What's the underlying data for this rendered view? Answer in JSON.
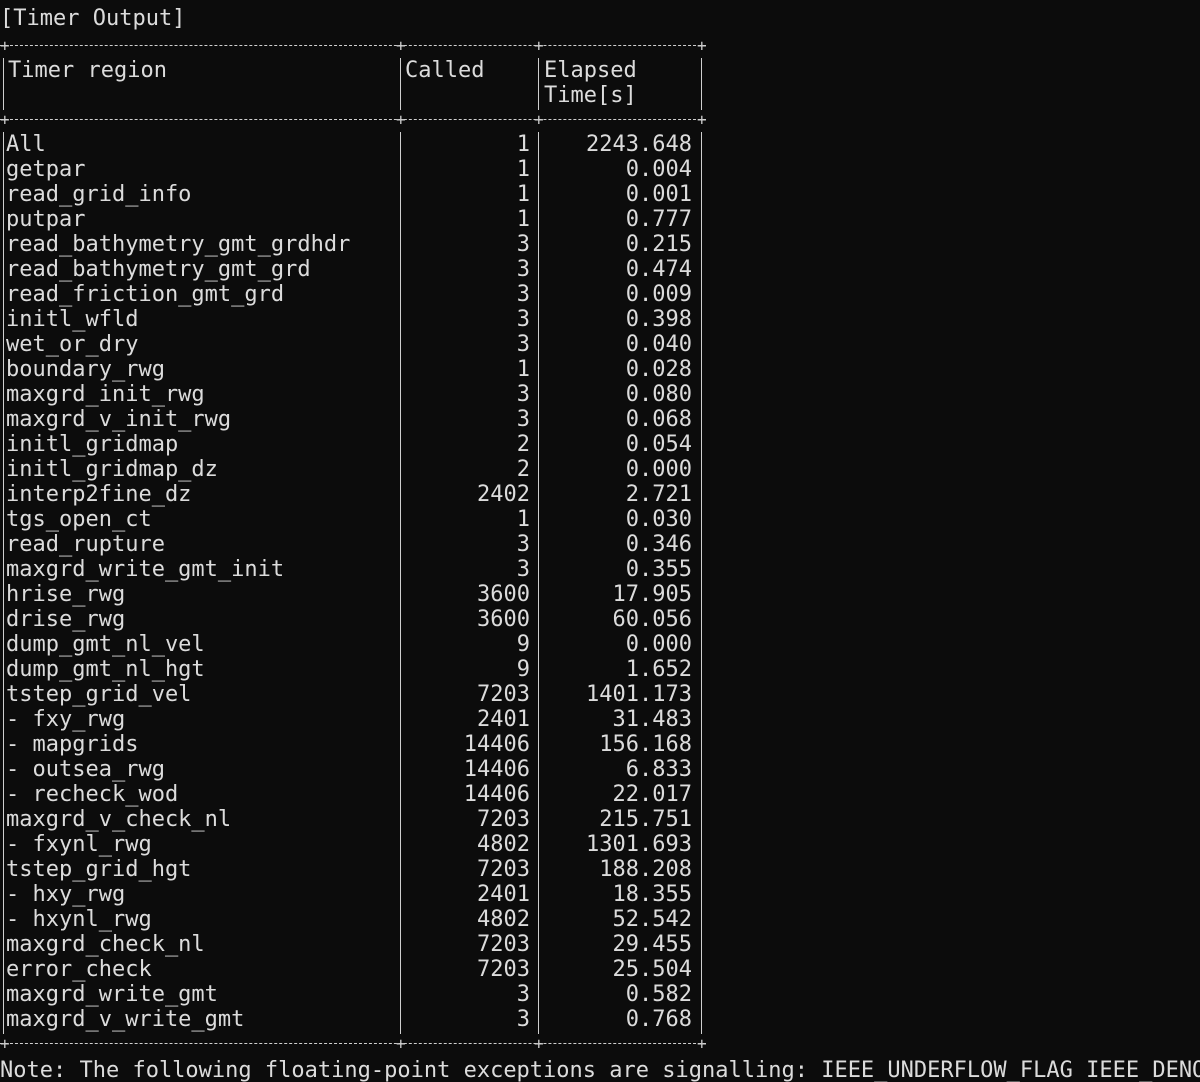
{
  "title": "[Timer Output]",
  "header": {
    "col1": "Timer region",
    "col2": "Called",
    "col3_line1": "Elapsed",
    "col3_line2": "Time[s]"
  },
  "rows": [
    {
      "name": "All",
      "called": "1",
      "elapsed": "2243.648"
    },
    {
      "name": "getpar",
      "called": "1",
      "elapsed": "0.004"
    },
    {
      "name": "read_grid_info",
      "called": "1",
      "elapsed": "0.001"
    },
    {
      "name": "putpar",
      "called": "1",
      "elapsed": "0.777"
    },
    {
      "name": "read_bathymetry_gmt_grdhdr",
      "called": "3",
      "elapsed": "0.215"
    },
    {
      "name": "read_bathymetry_gmt_grd",
      "called": "3",
      "elapsed": "0.474"
    },
    {
      "name": "read_friction_gmt_grd",
      "called": "3",
      "elapsed": "0.009"
    },
    {
      "name": "initl_wfld",
      "called": "3",
      "elapsed": "0.398"
    },
    {
      "name": "wet_or_dry",
      "called": "3",
      "elapsed": "0.040"
    },
    {
      "name": "boundary_rwg",
      "called": "1",
      "elapsed": "0.028"
    },
    {
      "name": "maxgrd_init_rwg",
      "called": "3",
      "elapsed": "0.080"
    },
    {
      "name": "maxgrd_v_init_rwg",
      "called": "3",
      "elapsed": "0.068"
    },
    {
      "name": "initl_gridmap",
      "called": "2",
      "elapsed": "0.054"
    },
    {
      "name": "initl_gridmap_dz",
      "called": "2",
      "elapsed": "0.000"
    },
    {
      "name": "interp2fine_dz",
      "called": "2402",
      "elapsed": "2.721"
    },
    {
      "name": "tgs_open_ct",
      "called": "1",
      "elapsed": "0.030"
    },
    {
      "name": "read_rupture",
      "called": "3",
      "elapsed": "0.346"
    },
    {
      "name": "maxgrd_write_gmt_init",
      "called": "3",
      "elapsed": "0.355"
    },
    {
      "name": "hrise_rwg",
      "called": "3600",
      "elapsed": "17.905"
    },
    {
      "name": "drise_rwg",
      "called": "3600",
      "elapsed": "60.056"
    },
    {
      "name": "dump_gmt_nl_vel",
      "called": "9",
      "elapsed": "0.000"
    },
    {
      "name": "dump_gmt_nl_hgt",
      "called": "9",
      "elapsed": "1.652"
    },
    {
      "name": "tstep_grid_vel",
      "called": "7203",
      "elapsed": "1401.173"
    },
    {
      "name": "- fxy_rwg",
      "called": "2401",
      "elapsed": "31.483"
    },
    {
      "name": "- mapgrids",
      "called": "14406",
      "elapsed": "156.168"
    },
    {
      "name": "- outsea_rwg",
      "called": "14406",
      "elapsed": "6.833"
    },
    {
      "name": "- recheck_wod",
      "called": "14406",
      "elapsed": "22.017"
    },
    {
      "name": "maxgrd_v_check_nl",
      "called": "7203",
      "elapsed": "215.751"
    },
    {
      "name": "- fxynl_rwg",
      "called": "4802",
      "elapsed": "1301.693"
    },
    {
      "name": "tstep_grid_hgt",
      "called": "7203",
      "elapsed": "188.208"
    },
    {
      "name": "- hxy_rwg",
      "called": "2401",
      "elapsed": "18.355"
    },
    {
      "name": "- hxynl_rwg",
      "called": "4802",
      "elapsed": "52.542"
    },
    {
      "name": "maxgrd_check_nl",
      "called": "7203",
      "elapsed": "29.455"
    },
    {
      "name": "error_check",
      "called": "7203",
      "elapsed": "25.504"
    },
    {
      "name": "maxgrd_write_gmt",
      "called": "3",
      "elapsed": "0.582"
    },
    {
      "name": "maxgrd_v_write_gmt",
      "called": "3",
      "elapsed": "0.768"
    }
  ],
  "note": "Note: The following floating-point exceptions are signalling: IEEE_UNDERFLOW_FLAG IEEE_DENORMAL",
  "colors": {
    "background": "#0c0c0c",
    "text": "#dcdcdc",
    "rule": "#cfcfcf"
  }
}
